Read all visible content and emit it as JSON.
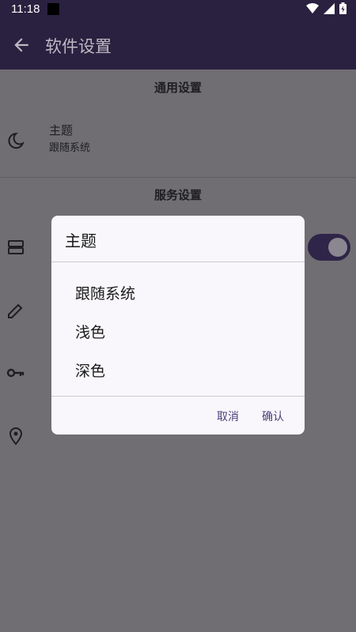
{
  "status_bar": {
    "time": "11:18",
    "icons": [
      "wifi-icon",
      "signal-icon",
      "battery-icon"
    ]
  },
  "app_bar": {
    "title": "软件设置",
    "back_icon": "arrow-left-icon"
  },
  "sections": {
    "general": {
      "header": "通用设置"
    },
    "service": {
      "header": "服务设置"
    }
  },
  "rows": {
    "theme": {
      "title": "主题",
      "subtitle": "跟随系统",
      "icon": "moon-icon"
    },
    "server": {
      "icon": "server-icon"
    },
    "edit": {
      "icon": "pencil-icon"
    },
    "key": {
      "icon": "key-icon"
    },
    "location": {
      "icon": "location-icon"
    }
  },
  "dialog": {
    "title": "主题",
    "options": [
      "跟随系统",
      "浅色",
      "深色"
    ],
    "cancel": "取消",
    "confirm": "确认"
  },
  "colors": {
    "appbar": "#2a2140",
    "scrim": "#706e73",
    "accent": "#4e3f7c",
    "dialog_bg": "#f9f7fb"
  }
}
